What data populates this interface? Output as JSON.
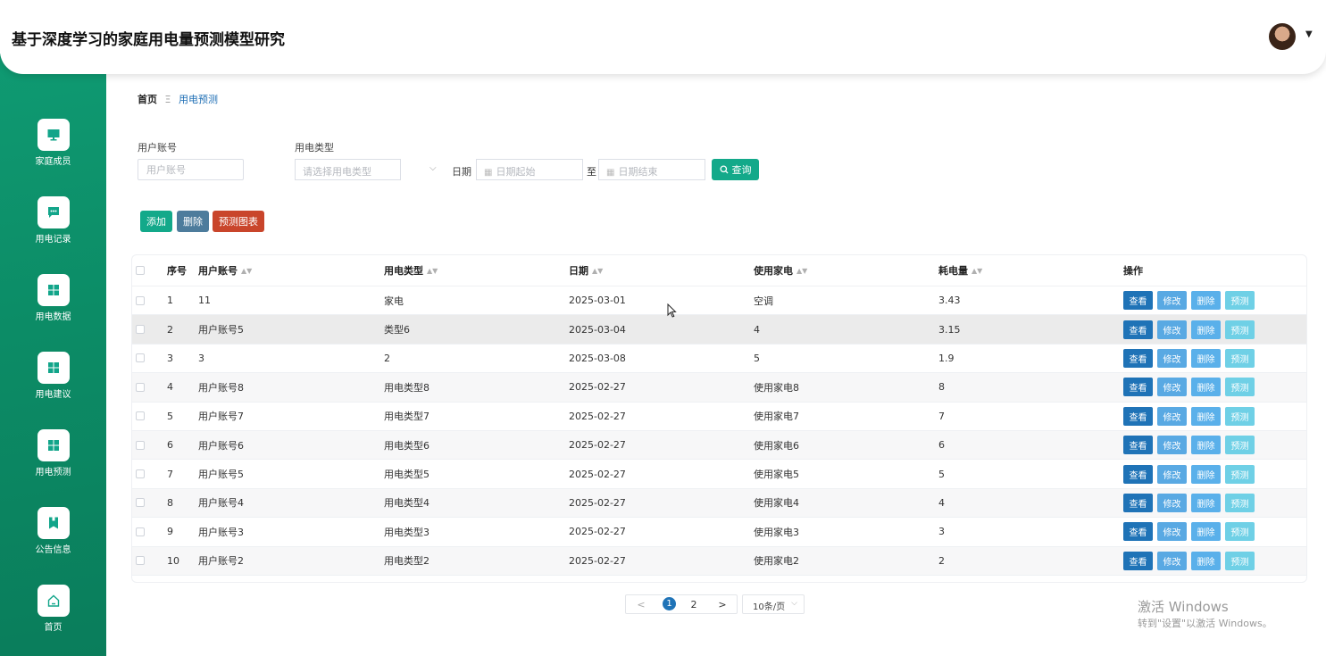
{
  "app": {
    "title": "基于深度学习的家庭用电量预测模型研究"
  },
  "sidebar": {
    "items": [
      {
        "label": "家庭成员",
        "icon": "monitor-icon"
      },
      {
        "label": "用电记录",
        "icon": "chat-icon"
      },
      {
        "label": "用电数据",
        "icon": "grid-icon"
      },
      {
        "label": "用电建议",
        "icon": "grid-icon"
      },
      {
        "label": "用电预测",
        "icon": "grid-icon"
      },
      {
        "label": "公告信息",
        "icon": "bookmark-icon"
      },
      {
        "label": "首页",
        "icon": "home-icon"
      }
    ]
  },
  "breadcrumb": {
    "home": "首页",
    "separator": "Ξ",
    "current": "用电预测"
  },
  "filters": {
    "account_label": "用户账号",
    "account_placeholder": "用户账号",
    "type_label": "用电类型",
    "type_placeholder": "请选择用电类型",
    "date_label": "日期",
    "date_start_placeholder": "日期起始",
    "date_to": "至",
    "date_end_placeholder": "日期结束",
    "search_label": "查询"
  },
  "actions": {
    "add": "添加",
    "delete": "删除",
    "chart": "预测图表"
  },
  "table": {
    "headers": {
      "index": "序号",
      "account": "用户账号",
      "type": "用电类型",
      "date": "日期",
      "appliance": "使用家电",
      "usage": "耗电量",
      "ops": "操作"
    },
    "op_labels": {
      "view": "查看",
      "edit": "修改",
      "delete": "删除",
      "predict": "预测"
    },
    "rows": [
      {
        "index": "1",
        "account": "11",
        "type": "家电",
        "date": "2025-03-01",
        "appliance": "空调",
        "usage": "3.43"
      },
      {
        "index": "2",
        "account": "用户账号5",
        "type": "类型6",
        "date": "2025-03-04",
        "appliance": "4",
        "usage": "3.15"
      },
      {
        "index": "3",
        "account": "3",
        "type": "2",
        "date": "2025-03-08",
        "appliance": "5",
        "usage": "1.9"
      },
      {
        "index": "4",
        "account": "用户账号8",
        "type": "用电类型8",
        "date": "2025-02-27",
        "appliance": "使用家电8",
        "usage": "8"
      },
      {
        "index": "5",
        "account": "用户账号7",
        "type": "用电类型7",
        "date": "2025-02-27",
        "appliance": "使用家电7",
        "usage": "7"
      },
      {
        "index": "6",
        "account": "用户账号6",
        "type": "用电类型6",
        "date": "2025-02-27",
        "appliance": "使用家电6",
        "usage": "6"
      },
      {
        "index": "7",
        "account": "用户账号5",
        "type": "用电类型5",
        "date": "2025-02-27",
        "appliance": "使用家电5",
        "usage": "5"
      },
      {
        "index": "8",
        "account": "用户账号4",
        "type": "用电类型4",
        "date": "2025-02-27",
        "appliance": "使用家电4",
        "usage": "4"
      },
      {
        "index": "9",
        "account": "用户账号3",
        "type": "用电类型3",
        "date": "2025-02-27",
        "appliance": "使用家电3",
        "usage": "3"
      },
      {
        "index": "10",
        "account": "用户账号2",
        "type": "用电类型2",
        "date": "2025-02-27",
        "appliance": "使用家电2",
        "usage": "2"
      }
    ]
  },
  "pagination": {
    "prev": "<",
    "pages": [
      "1",
      "2"
    ],
    "current": "1",
    "next": ">",
    "page_size": "10条/页"
  },
  "watermark": {
    "title": "激活 Windows",
    "subtitle": "转到\"设置\"以激活 Windows。"
  },
  "colors": {
    "sidebar": "#0f9a72",
    "primary": "#13a98a",
    "danger": "#c9452b",
    "slate": "#4d7c9c",
    "view": "#1f73b7"
  }
}
